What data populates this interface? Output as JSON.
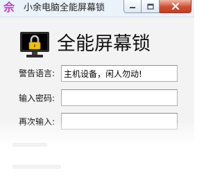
{
  "window": {
    "title": "小余电脑全能屏幕锁",
    "app_icon_glyph": "佘"
  },
  "colors": {
    "accent": "#c23ac9",
    "close_button": "#cf4d31",
    "lock_body": "#f2c200"
  },
  "header": {
    "title": "全能屏幕锁",
    "icon": "monitor-lock-icon"
  },
  "form": {
    "warning_label": "警告语言:",
    "warning_value": "主机设备，闲人勿动!",
    "password_label": "输入密码:",
    "password_value": "",
    "confirm_label": "再次输入:",
    "confirm_value": ""
  }
}
